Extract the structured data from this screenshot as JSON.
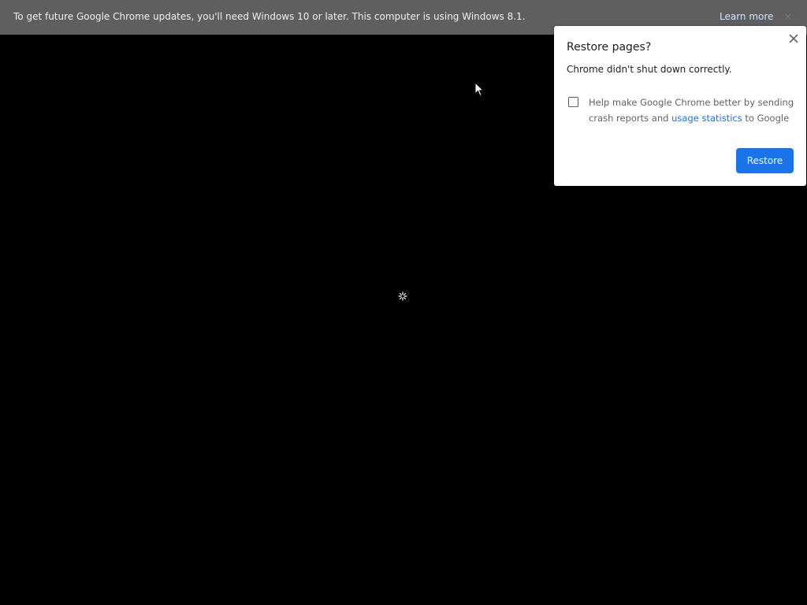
{
  "infobar": {
    "message": "To get future Google Chrome updates, you'll need Windows 10 or later. This computer is using Windows 8.1.",
    "learn_more_label": "Learn more",
    "close_icon": "close-icon"
  },
  "dialog": {
    "title": "Restore pages?",
    "message": "Chrome didn't shut down correctly.",
    "checkbox_checked": false,
    "checkbox_text_before": "Help make Google Chrome better by sending crash reports and ",
    "checkbox_link": "usage statistics",
    "checkbox_text_after": " to Google",
    "restore_label": "Restore",
    "close_icon": "close-icon"
  },
  "viewport": {
    "spinner_icon": "loading-spinner-icon",
    "cursor_icon": "mouse-pointer-icon"
  },
  "colors": {
    "infobar_background": "#5f5f5f",
    "link_blue": "#1a73e8",
    "page_background": "#000000",
    "dialog_background": "#ffffff"
  }
}
